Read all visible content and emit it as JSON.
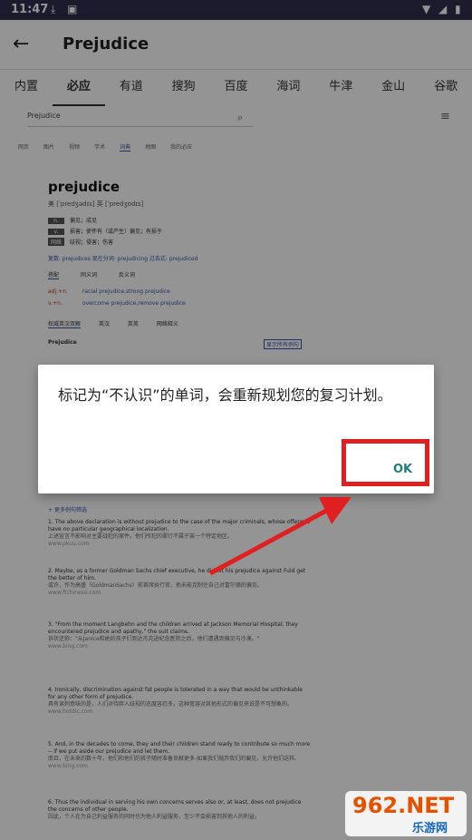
{
  "status_bar": {
    "time": "11:47"
  },
  "appbar": {
    "title": "Prejudice"
  },
  "tabs": [
    "内置",
    "必应",
    "有道",
    "搜狗",
    "百度",
    "海词",
    "牛津",
    "金山",
    "谷歌"
  ],
  "content": {
    "search_value": "Prejudice",
    "subtabs": [
      "网页",
      "图片",
      "视频",
      "学术",
      "词典",
      "地图",
      "我的必应"
    ],
    "word": "prejudice",
    "phonetics": "美 [ˈpredʒədɪs]   英 [ˈpredʒʊdɪs]",
    "defs": [
      {
        "pos": "n.",
        "text": "偏见；成见"
      },
      {
        "pos": "v.",
        "text": "损害；使怀有（或产生）偏见；有损于"
      },
      {
        "pos": "网络",
        "text": "歧视；侵害；伤害"
      }
    ],
    "forms": "复数: prejudices   现在分词: prejudicing   过去式: prejudiced",
    "tabs2": [
      "搭配",
      "同义词",
      "反义词"
    ],
    "collocations": [
      {
        "pos": "adj.+n.",
        "text": "racial prejudice,strong prejudice"
      },
      {
        "pos": "v.+n.",
        "text": "overcome prejudice,remove prejudice"
      }
    ],
    "tabs3": [
      "权威英汉双解",
      "英汉",
      "英英",
      "网络释义"
    ],
    "section_title": "Prejudice",
    "show_all": "显示所有例句",
    "more_examples": "更多例句筛选",
    "examples": [
      {
        "en": "1. The above declaration is without prejudice to the case of the major criminals, whose offenses have no particular geographical localization.",
        "zh": "上述宣言不影响对主要战犯的案件。他们所犯的罪行不属于某一个特定地区。",
        "src": "www.pkuu.com"
      },
      {
        "en": "2. Maybe, as a former Goldman Sachs chief executive, he did let his prejudice against Fuld get the better of him.",
        "zh": "或许，作为高盛（GoldmanSachs）前首席执行官，他未能克制住自己对富尔德的偏见。",
        "src": "www.ftchinese.com"
      },
      {
        "en": "3. \"From the moment Langbehn and the children arrived at Jackson Memorial Hospital, they encountered prejudice and apathy,\" the suit claims.",
        "zh": "诉状还称：\"从Janice和她的孩子们到达杰克逊纪念医院之后，他们遭遇到偏见与冷漠。\"",
        "src": "www.bing.com"
      },
      {
        "en": "4. Ironically, discrimination against fat people is tolerated in a way that would be unthinkable for any other form of prejudice.",
        "zh": "具有讽刺意味的是，人们对待胖人歧视的态度容忍多，这种宽容对其他形式的偏见来说是不可想象的。",
        "src": "www.hotdic.com"
      },
      {
        "en": "5. And, in the decades to come, they and their children stand ready to contribute so much more -- if we put aside our prejudice and let them.",
        "zh": "而且，在未来的数十年，他们和他们的孩子随时准备贡献更多-如果我们抛弃我们的偏见，允许他们这样。",
        "src": "www.bing.com"
      },
      {
        "en": "6. Thus the individual in serving his own concerns serves also or, at least, does not prejudice the concerns of other people.",
        "zh": "因此，个人在为自己利益服务的同时也为他人利益服务，至少不会损害到其他人的利益。",
        "src": ""
      }
    ]
  },
  "dialog": {
    "message": "标记为“不认识”的单词，会重新规划您的复习计划。",
    "ok_label": "OK"
  },
  "watermark": {
    "brand": "962.NET",
    "sub": "乐游网"
  },
  "colors": {
    "accent": "#1e7f7f",
    "highlight": "#e02020",
    "status_bar": "#2f2f4f"
  }
}
